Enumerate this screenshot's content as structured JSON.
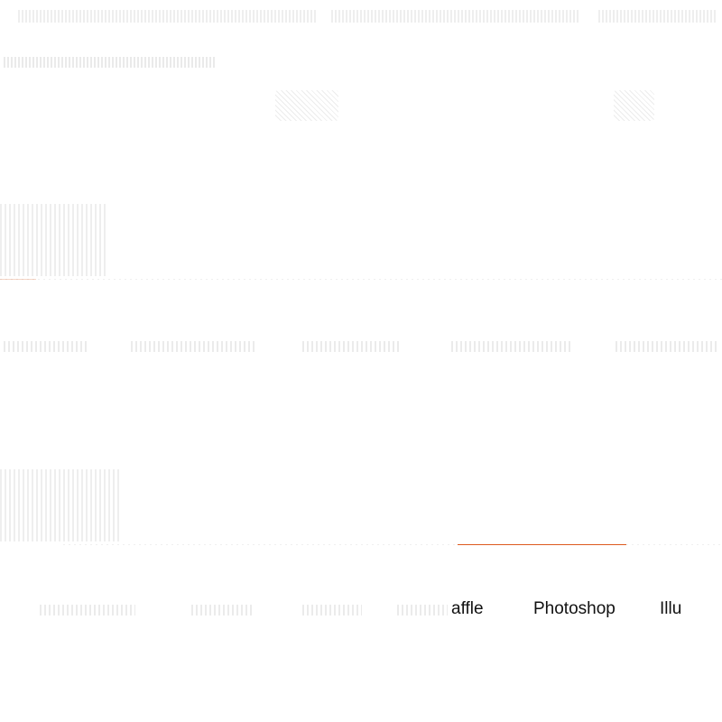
{
  "colors": {
    "accent": "#dd5a1e",
    "text": "#111111",
    "ghost": "#f0f0f0",
    "background": "#ffffff"
  },
  "section2": {
    "tabs": [
      {
        "label": "affle"
      },
      {
        "label": "Photoshop"
      },
      {
        "label": "Illu"
      }
    ]
  }
}
